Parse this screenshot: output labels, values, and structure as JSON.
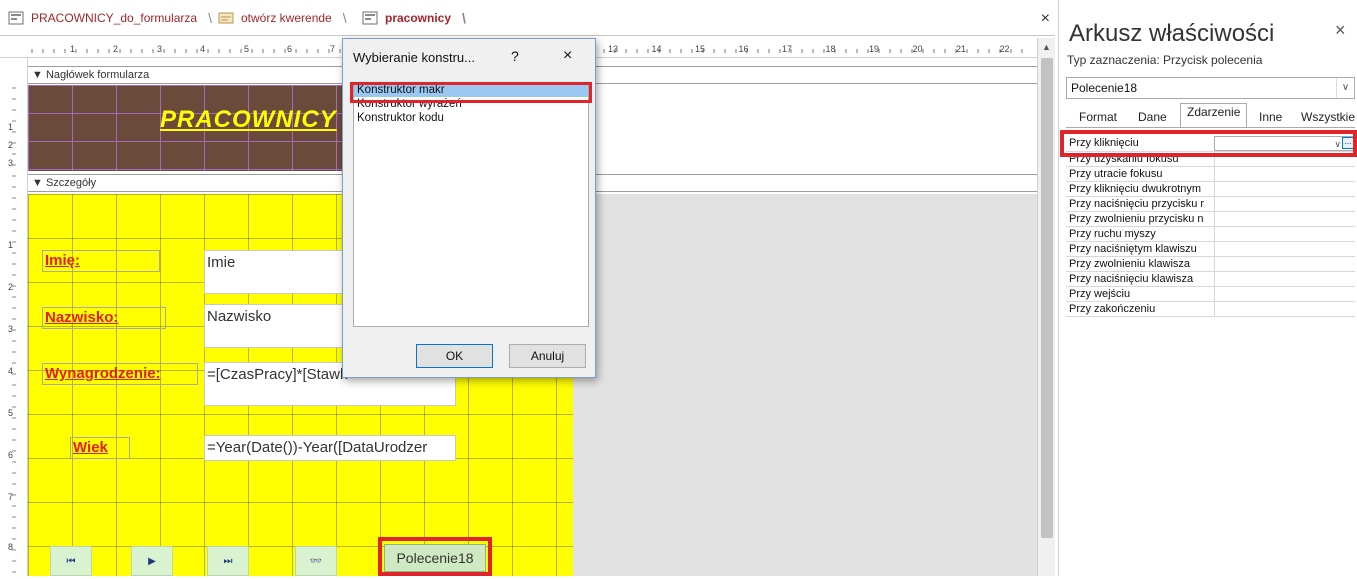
{
  "tabs": [
    {
      "label": "PRACOWNICY_do_formularza",
      "icon": "form-icon"
    },
    {
      "label": "otwórz kwerende",
      "icon": "macro-icon"
    },
    {
      "label": "pracownicy",
      "icon": "form-icon",
      "active": true
    }
  ],
  "tab_close": "×",
  "ruler": {
    "numbers": [
      "1",
      "2",
      "3",
      "4",
      "5",
      "6",
      "7",
      "13",
      "14",
      "15",
      "16",
      "17",
      "18",
      "19",
      "20",
      "21",
      "22"
    ],
    "vnumbers": [
      "1",
      "2",
      "3",
      "1",
      "2",
      "3",
      "4",
      "5",
      "6",
      "7",
      "8"
    ]
  },
  "sections": {
    "header_label": "Nagłówek formularza",
    "detail_label": "Szczegóły"
  },
  "form": {
    "title": "PRACOWNICY",
    "labels": {
      "imie": "Imię:",
      "nazwisko": "Nazwisko:",
      "wynagrodzenie": "Wynagrodzenie:",
      "wiek": "Wiek"
    },
    "fields": {
      "imie": "Imie",
      "nazwisko": "Nazwisko",
      "wynagrodzenie": "=[CzasPracy]*[Stawk",
      "wiek": "=Year(Date())-Year([DataUrodzer"
    },
    "nav_buttons": [
      {
        "icon": "first-record-icon",
        "glyph": "⏮"
      },
      {
        "icon": "next-record-icon",
        "glyph": "▶"
      },
      {
        "icon": "last-record-icon",
        "glyph": "⏭"
      },
      {
        "icon": "find-binoculars-icon",
        "glyph": "👓"
      }
    ],
    "command_button": "Polecenie18"
  },
  "dialog": {
    "title": "Wybieranie konstru...",
    "help": "?",
    "close": "×",
    "items": [
      "Konstruktor makr",
      "Konstruktor wyrażeń",
      "Konstruktor kodu"
    ],
    "selected_index": 0,
    "ok": "OK",
    "cancel": "Anuluj"
  },
  "properties": {
    "title": "Arkusz właściwości",
    "close": "×",
    "selection_type": "Typ zaznaczenia: Przycisk polecenia",
    "object": "Polecenie18",
    "tabs": [
      "Format",
      "Dane",
      "Zdarzenie",
      "Inne",
      "Wszystkie"
    ],
    "active_tab": "Zdarzenie",
    "rows": [
      "Przy kliknięciu",
      "Przy uzyskaniu fokusu",
      "Przy utracie fokusu",
      "Przy kliknięciu dwukrotnym",
      "Przy naciśnięciu przycisku r",
      "Przy zwolnieniu przycisku n",
      "Przy ruchu myszy",
      "Przy naciśniętym klawiszu",
      "Przy zwolnieniu klawisza",
      "Przy naciśnięciu klawisza",
      "Przy wejściu",
      "Przy zakończeniu"
    ]
  },
  "colors": {
    "accent_red": "#e0242b",
    "header_brown": "#6a4a3a",
    "detail_yellow": "#ffff00",
    "label_red": "#e51c23",
    "tab_text": "#a4262c"
  }
}
